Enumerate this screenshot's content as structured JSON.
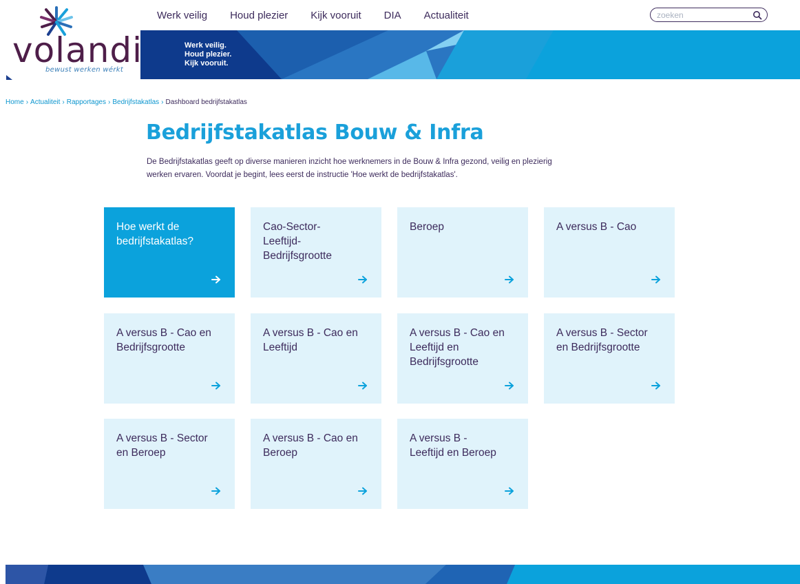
{
  "brand": {
    "name": "volandis",
    "tagline": "bewust werken wérkt",
    "logo_icon": "star-burst-icon",
    "colors": {
      "purple": "#4e1e49",
      "dark_blue": "#1c3f8f",
      "mid_blue": "#2a6fb8",
      "cyan": "#0ba2dc",
      "tile_bg": "#e0f3fb",
      "text": "#3d2b5c"
    }
  },
  "nav": {
    "items": [
      "Werk veilig",
      "Houd plezier",
      "Kijk vooruit",
      "DIA",
      "Actualiteit"
    ]
  },
  "search": {
    "placeholder": "zoeken",
    "icon": "search-icon"
  },
  "banner": {
    "lines": [
      "Werk veilig.",
      "Houd plezier.",
      "Kijk vooruit."
    ]
  },
  "breadcrumb": {
    "links": [
      "Home",
      "Actualiteit",
      "Rapportages",
      "Bedrijfstakatlas"
    ],
    "separator": "›",
    "current": "Dashboard bedrijfstakatlas"
  },
  "main": {
    "title": "Bedrijfstakatlas Bouw & Infra",
    "intro_lines": [
      "De Bedrijfstakatlas geeft op diverse manieren inzicht hoe werknemers in de Bouw & Infra gezond, veilig en plezierig",
      "werken ervaren. Voordat je begint, lees eerst de instructie 'Hoe werkt de bedrijfstakatlas'."
    ]
  },
  "tiles": [
    {
      "lines": [
        "Hoe werkt de",
        "bedrijfstakatlas?"
      ],
      "active": true
    },
    {
      "lines": [
        "Cao-Sector-",
        "Leeftijd-",
        "Bedrijfsgrootte"
      ],
      "active": false
    },
    {
      "lines": [
        "Beroep"
      ],
      "active": false
    },
    {
      "lines": [
        "A versus B - Cao"
      ],
      "active": false
    },
    {
      "lines": [
        "A versus B - Cao en",
        "Bedrijfsgrootte"
      ],
      "active": false
    },
    {
      "lines": [
        "A versus B - Cao en",
        "Leeftijd"
      ],
      "active": false
    },
    {
      "lines": [
        "A versus B - Cao en",
        "Leeftijd en",
        "Bedrijfsgrootte"
      ],
      "active": false
    },
    {
      "lines": [
        "A versus B - Sector",
        "en Bedrijfsgrootte"
      ],
      "active": false
    },
    {
      "lines": [
        "A versus B - Sector",
        "en Beroep"
      ],
      "active": false
    },
    {
      "lines": [
        "A versus B - Cao en",
        "Beroep"
      ],
      "active": false
    },
    {
      "lines": [
        "A versus B -",
        "Leeftijd en Beroep"
      ],
      "active": false
    }
  ],
  "tile_arrow_icon": "arrow-right-icon"
}
